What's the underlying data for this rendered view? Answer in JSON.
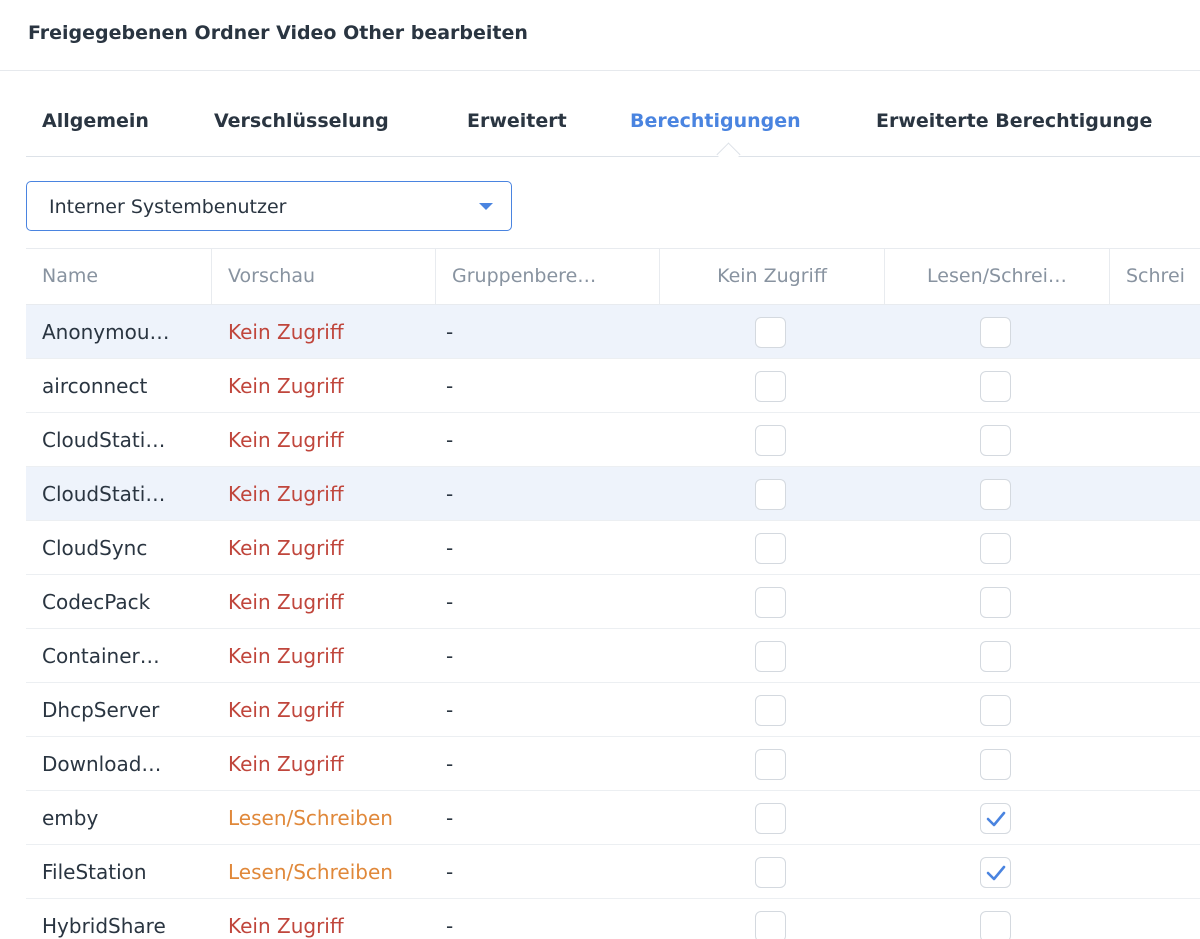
{
  "dialog": {
    "title": "Freigegebenen Ordner Video Other bearbeiten"
  },
  "tabs": [
    {
      "label": "Allgemein",
      "active": false
    },
    {
      "label": "Verschlüsselung",
      "active": false
    },
    {
      "label": "Erweitert",
      "active": false
    },
    {
      "label": "Berechtigungen",
      "active": true
    },
    {
      "label": "Erweiterte Berechtigunge",
      "active": false
    }
  ],
  "user_type_select": {
    "value": "Interner Systembenutzer"
  },
  "table": {
    "columns": {
      "name": "Name",
      "preview": "Vorschau",
      "group": "Gruppenbere…",
      "no_access": "Kein Zugriff",
      "read_write": "Lesen/Schrei…",
      "read_only": "Schrei"
    },
    "rows": [
      {
        "name": "Anonymou…",
        "preview": "Kein Zugriff",
        "group": "-",
        "no_access": false,
        "read_write": false,
        "selected": true
      },
      {
        "name": "airconnect",
        "preview": "Kein Zugriff",
        "group": "-",
        "no_access": false,
        "read_write": false,
        "selected": false
      },
      {
        "name": "CloudStati…",
        "preview": "Kein Zugriff",
        "group": "-",
        "no_access": false,
        "read_write": false,
        "selected": false
      },
      {
        "name": "CloudStati…",
        "preview": "Kein Zugriff",
        "group": "-",
        "no_access": false,
        "read_write": false,
        "selected": true
      },
      {
        "name": "CloudSync",
        "preview": "Kein Zugriff",
        "group": "-",
        "no_access": false,
        "read_write": false,
        "selected": false
      },
      {
        "name": "CodecPack",
        "preview": "Kein Zugriff",
        "group": "-",
        "no_access": false,
        "read_write": false,
        "selected": false
      },
      {
        "name": "Container…",
        "preview": "Kein Zugriff",
        "group": "-",
        "no_access": false,
        "read_write": false,
        "selected": false
      },
      {
        "name": "DhcpServer",
        "preview": "Kein Zugriff",
        "group": "-",
        "no_access": false,
        "read_write": false,
        "selected": false
      },
      {
        "name": "Download…",
        "preview": "Kein Zugriff",
        "group": "-",
        "no_access": false,
        "read_write": false,
        "selected": false
      },
      {
        "name": "emby",
        "preview": "Lesen/Schreiben",
        "group": "-",
        "no_access": false,
        "read_write": true,
        "selected": false
      },
      {
        "name": "FileStation",
        "preview": "Lesen/Schreiben",
        "group": "-",
        "no_access": false,
        "read_write": true,
        "selected": false
      },
      {
        "name": "HybridShare",
        "preview": "Kein Zugriff",
        "group": "-",
        "no_access": false,
        "read_write": false,
        "selected": false
      }
    ]
  },
  "colors": {
    "accent": "#4a84e0",
    "no_access_text": "#c0463c",
    "read_write_text": "#e0883a",
    "selected_row": "#eef3fb"
  }
}
